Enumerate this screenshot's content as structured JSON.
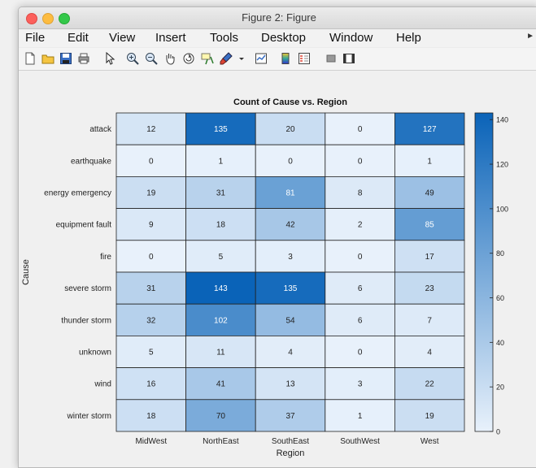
{
  "window": {
    "title": "Figure 2: Figure"
  },
  "menu": [
    "File",
    "Edit",
    "View",
    "Insert",
    "Tools",
    "Desktop",
    "Window",
    "Help"
  ],
  "toolbar": [
    {
      "name": "new-figure-icon"
    },
    {
      "name": "open-file-icon"
    },
    {
      "name": "save-icon"
    },
    {
      "name": "print-icon"
    },
    {
      "name": "pointer-icon"
    },
    {
      "name": "zoom-in-icon"
    },
    {
      "name": "zoom-out-icon"
    },
    {
      "name": "pan-hand-icon"
    },
    {
      "name": "rotate-3d-icon"
    },
    {
      "name": "data-cursor-icon"
    },
    {
      "name": "brush-icon"
    },
    {
      "name": "brush-dropdown-icon"
    },
    {
      "name": "link-plot-icon"
    },
    {
      "name": "colorbar-icon"
    },
    {
      "name": "legend-icon"
    },
    {
      "name": "hide-plot-tools-icon"
    },
    {
      "name": "show-plot-tools-icon"
    }
  ],
  "colors": {
    "low": "#e8f1fb",
    "high": "#0a63b8",
    "cell_border": "#222222",
    "text_dark": "#222222",
    "text_light": "#ffffff"
  },
  "chart_data": {
    "type": "heatmap",
    "title": "Count of Cause vs. Region",
    "xlabel": "Region",
    "ylabel": "Cause",
    "x": [
      "MidWest",
      "NorthEast",
      "SouthEast",
      "SouthWest",
      "West"
    ],
    "y": [
      "attack",
      "earthquake",
      "energy emergency",
      "equipment fault",
      "fire",
      "severe storm",
      "thunder storm",
      "unknown",
      "wind",
      "winter storm"
    ],
    "values": [
      [
        12,
        135,
        20,
        0,
        127
      ],
      [
        0,
        1,
        0,
        0,
        1
      ],
      [
        19,
        31,
        81,
        8,
        49
      ],
      [
        9,
        18,
        42,
        2,
        85
      ],
      [
        0,
        5,
        3,
        0,
        17
      ],
      [
        31,
        143,
        135,
        6,
        23
      ],
      [
        32,
        102,
        54,
        6,
        7
      ],
      [
        5,
        11,
        4,
        0,
        4
      ],
      [
        16,
        41,
        13,
        3,
        22
      ],
      [
        18,
        70,
        37,
        1,
        19
      ]
    ],
    "colorbar": {
      "min": 0,
      "max": 143,
      "ticks": [
        0,
        20,
        40,
        60,
        80,
        100,
        120,
        140
      ]
    }
  }
}
